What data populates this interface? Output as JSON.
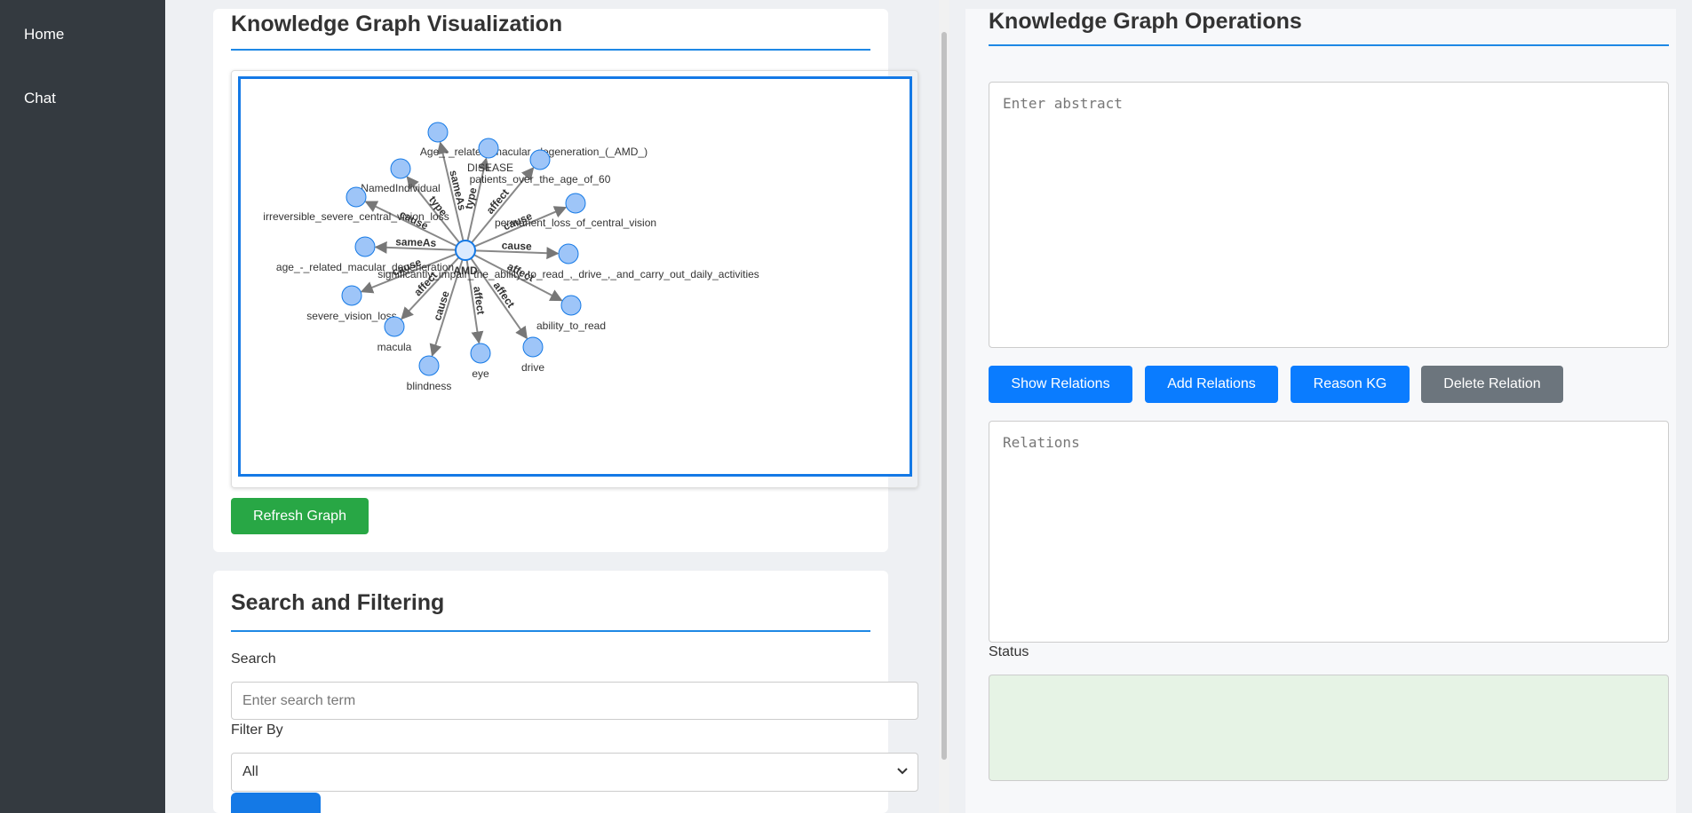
{
  "sidebar": {
    "items": [
      {
        "label": "Home"
      },
      {
        "label": "Chat"
      }
    ]
  },
  "visualization": {
    "title": "Knowledge Graph Visualization",
    "refresh_label": "Refresh Graph",
    "graph": {
      "center": "AMD",
      "node_color": "#9ec5f8",
      "edge_color": "#888888",
      "frame_color": "#1479e6",
      "edges": [
        {
          "target": "Age_-_related_macular_degeneration_(_AMD_)",
          "relation": "sameAs"
        },
        {
          "target": "DISEASE",
          "relation": "type"
        },
        {
          "target": "patients_over_the_age_of_60",
          "relation": "affect"
        },
        {
          "target": "NamedIndividual",
          "relation": "type"
        },
        {
          "target": "irreversible_severe_central_vision_loss",
          "relation": "cause"
        },
        {
          "target": "permanent_loss_of_central_vision",
          "relation": "cause"
        },
        {
          "target": "age_-_related_macular_degeneration",
          "relation": "sameAs"
        },
        {
          "target": "significantly_impair_the_ability_to_read_,_drive_,_and_carry_out_daily_activities",
          "relation": "cause"
        },
        {
          "target": "severe_vision_loss",
          "relation": "cause"
        },
        {
          "target": "ability_to_read",
          "relation": "affect"
        },
        {
          "target": "macula",
          "relation": "affect"
        },
        {
          "target": "blindness",
          "relation": "cause"
        },
        {
          "target": "eye",
          "relation": "affect"
        },
        {
          "target": "drive",
          "relation": "affect"
        }
      ]
    }
  },
  "search": {
    "title": "Search and Filtering",
    "search_label": "Search",
    "search_placeholder": "Enter search term",
    "filter_label": "Filter By",
    "filter_value": "All"
  },
  "operations": {
    "title": "Knowledge Graph Operations",
    "abstract_placeholder": "Enter abstract",
    "buttons": {
      "show": "Show Relations",
      "add": "Add Relations",
      "reason": "Reason KG",
      "delete": "Delete Relation"
    },
    "relations_placeholder": "Relations",
    "status_label": "Status",
    "status_bg": "#e6f3e5"
  }
}
